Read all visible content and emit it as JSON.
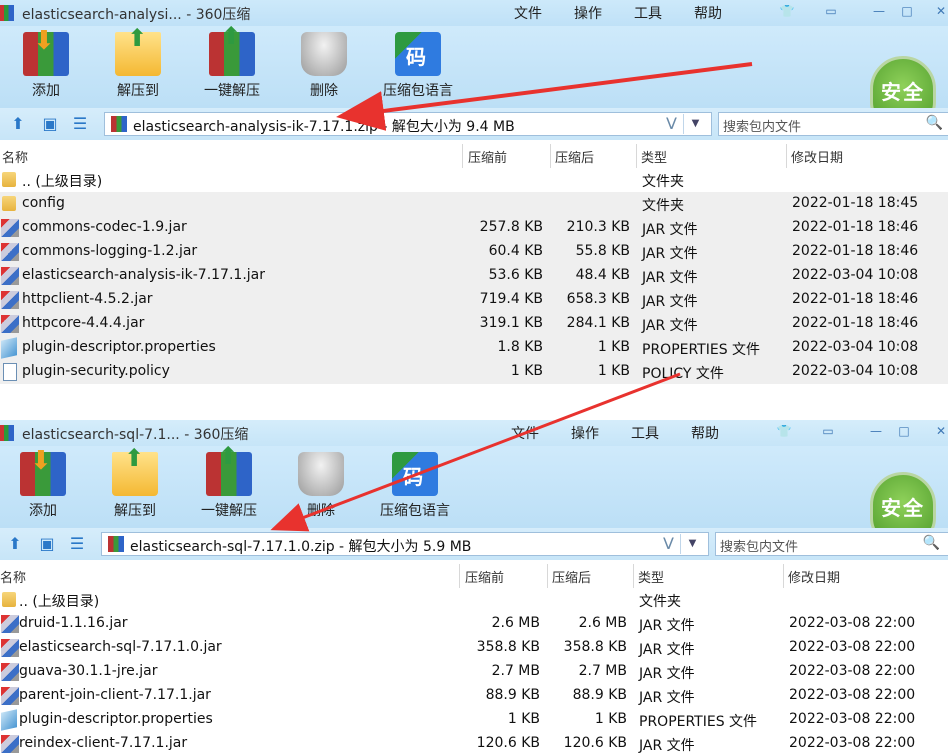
{
  "windows": [
    {
      "title": "elasticsearch-analysi... - 360压缩",
      "menu": [
        "文件",
        "操作",
        "工具",
        "帮助"
      ],
      "toolbar": {
        "add": "添加",
        "extract": "解压到",
        "oneclick": "一键解压",
        "delete": "删除",
        "encoding": "压缩包语言"
      },
      "shield": "安全",
      "address": "elasticsearch-analysis-ik-7.17.1.zip - 解包大小为 9.4 MB",
      "address_v": "V",
      "search_placeholder": "搜索包内文件",
      "columns": {
        "name": "名称",
        "packed": "压缩前",
        "compressed": "压缩后",
        "type": "类型",
        "modified": "修改日期"
      },
      "files": [
        {
          "icon": "folder",
          "name": ".. (上级目录)",
          "packed": "",
          "compressed": "",
          "type": "文件夹",
          "modified": ""
        },
        {
          "icon": "folder",
          "name": "config",
          "packed": "",
          "compressed": "",
          "type": "文件夹",
          "modified": "2022-01-18 18:45"
        },
        {
          "icon": "jar",
          "name": "commons-codec-1.9.jar",
          "packed": "257.8 KB",
          "compressed": "210.3 KB",
          "type": "JAR 文件",
          "modified": "2022-01-18 18:46"
        },
        {
          "icon": "jar",
          "name": "commons-logging-1.2.jar",
          "packed": "60.4 KB",
          "compressed": "55.8 KB",
          "type": "JAR 文件",
          "modified": "2022-01-18 18:46"
        },
        {
          "icon": "jar",
          "name": "elasticsearch-analysis-ik-7.17.1.jar",
          "packed": "53.6 KB",
          "compressed": "48.4 KB",
          "type": "JAR 文件",
          "modified": "2022-03-04 10:08"
        },
        {
          "icon": "jar",
          "name": "httpclient-4.5.2.jar",
          "packed": "719.4 KB",
          "compressed": "658.3 KB",
          "type": "JAR 文件",
          "modified": "2022-01-18 18:46"
        },
        {
          "icon": "jar",
          "name": "httpcore-4.4.4.jar",
          "packed": "319.1 KB",
          "compressed": "284.1 KB",
          "type": "JAR 文件",
          "modified": "2022-01-18 18:46"
        },
        {
          "icon": "props",
          "name": "plugin-descriptor.properties",
          "packed": "1.8 KB",
          "compressed": "1 KB",
          "type": "PROPERTIES 文件",
          "modified": "2022-03-04 10:08"
        },
        {
          "icon": "policy",
          "name": "plugin-security.policy",
          "packed": "1 KB",
          "compressed": "1 KB",
          "type": "POLICY 文件",
          "modified": "2022-03-04 10:08"
        }
      ]
    },
    {
      "title": "elasticsearch-sql-7.1... - 360压缩",
      "menu": [
        "文件",
        "操作",
        "工具",
        "帮助"
      ],
      "toolbar": {
        "add": "添加",
        "extract": "解压到",
        "oneclick": "一键解压",
        "delete": "删除",
        "encoding": "压缩包语言"
      },
      "shield": "安全",
      "address": "elasticsearch-sql-7.17.1.0.zip - 解包大小为 5.9 MB",
      "address_v": "V",
      "search_placeholder": "搜索包内文件",
      "columns": {
        "name": "名称",
        "packed": "压缩前",
        "compressed": "压缩后",
        "type": "类型",
        "modified": "修改日期"
      },
      "files": [
        {
          "icon": "folder",
          "name": ".. (上级目录)",
          "packed": "",
          "compressed": "",
          "type": "文件夹",
          "modified": ""
        },
        {
          "icon": "jar",
          "name": "druid-1.1.16.jar",
          "packed": "2.6 MB",
          "compressed": "2.6 MB",
          "type": "JAR 文件",
          "modified": "2022-03-08 22:00"
        },
        {
          "icon": "jar",
          "name": "elasticsearch-sql-7.17.1.0.jar",
          "packed": "358.8 KB",
          "compressed": "358.8 KB",
          "type": "JAR 文件",
          "modified": "2022-03-08 22:00"
        },
        {
          "icon": "jar",
          "name": "guava-30.1.1-jre.jar",
          "packed": "2.7 MB",
          "compressed": "2.7 MB",
          "type": "JAR 文件",
          "modified": "2022-03-08 22:00"
        },
        {
          "icon": "jar",
          "name": "parent-join-client-7.17.1.jar",
          "packed": "88.9 KB",
          "compressed": "88.9 KB",
          "type": "JAR 文件",
          "modified": "2022-03-08 22:00"
        },
        {
          "icon": "props",
          "name": "plugin-descriptor.properties",
          "packed": "1 KB",
          "compressed": "1 KB",
          "type": "PROPERTIES 文件",
          "modified": "2022-03-08 22:00"
        },
        {
          "icon": "jar",
          "name": "reindex-client-7.17.1.jar",
          "packed": "120.6 KB",
          "compressed": "120.6 KB",
          "type": "JAR 文件",
          "modified": "2022-03-08 22:00"
        }
      ]
    }
  ],
  "colors": {
    "annotation_arrow": "#e8322e"
  }
}
